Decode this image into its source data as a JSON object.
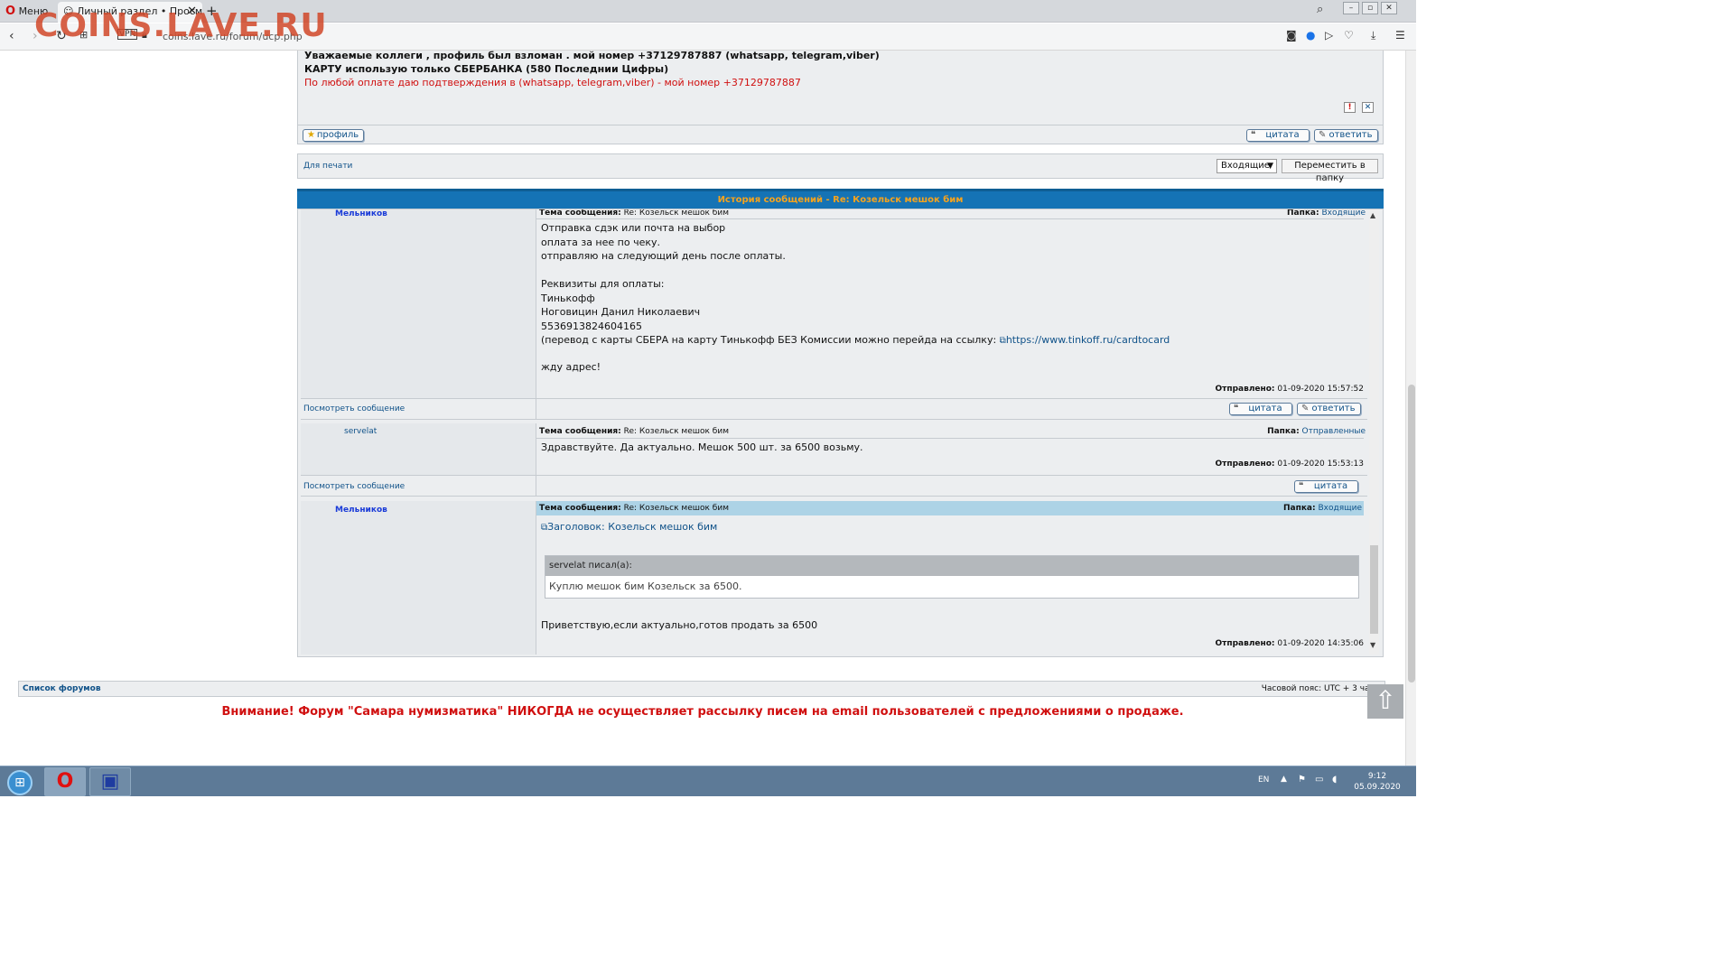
{
  "browser": {
    "menu_label": "Меню",
    "tab_title": "Личный раздел • Просмо",
    "url": "coins.lave.ru/forum/ucp.php",
    "watermark": "COINS.LAVE.RU"
  },
  "top_post": {
    "line1": "Уважаемые коллеги , профиль был взломан . мой номер +37129787887 (whatsapp, telegram,viber)",
    "line2": "КАРТУ использую только СБЕРБАНКА (580 Последнии Цифры)",
    "line3": "По любой оплате даю подтверждения в (whatsapp, telegram,viber) - мой номер +37129787887",
    "profile_label": "профиль",
    "quote_label": "цитата",
    "reply_label": "ответить"
  },
  "actions_row": {
    "print_label": "Для печати",
    "folder_select": "Входящие",
    "move_button": "Переместить в папку"
  },
  "history": {
    "header": "История сообщений - Re: Козельск мешок бим",
    "subject_label": "Тема сообщения:",
    "folder_label": "Папка:",
    "sent_label": "Отправлено:",
    "view_message": "Посмотреть сообщение",
    "quote_label": "цитата",
    "reply_label": "ответить",
    "messages": [
      {
        "author": "Мельников",
        "subject": "Re: Козельск мешок бим",
        "folder": "Входящие",
        "body": "Отправка сдэк или почта на выбор\nоплата за нее по чеку.\nотправляю на следующий день после оплаты.\n\nРеквизиты для оплаты:\nТинькофф\nНоговицин Данил Николаевич\n5536913824604165",
        "body_link_prefix": "(перевод с карты СБЕРА на карту Тинькофф БЕЗ Комиссии можно перейда на ссылку: ",
        "body_link": "https://www.tinkoff.ru/cardtocard",
        "body_end": "жду адрес!",
        "sent": "01-09-2020 15:57:52"
      },
      {
        "author": "servelat",
        "subject": "Re: Козельск мешок бим",
        "folder": "Отправленные",
        "body": "Здравствуйте. Да актуально. Мешок 500 шт. за 6500 возьму.",
        "sent": "01-09-2020 15:53:13"
      },
      {
        "author": "Мельников",
        "subject": "Re: Козельск мешок бим",
        "folder": "Входящие",
        "title_link": "Заголовок: Козельск мешок бим",
        "quote_author": "servelat писал(а):",
        "quote_text": "Куплю мешок бим Козельск за 6500.",
        "body": "Приветствую,если актуально,готов продать за 6500",
        "sent": "01-09-2020 14:35:06"
      }
    ]
  },
  "footer": {
    "forums_list": "Список форумов",
    "timezone": "Часовой пояс: UTC + 3 часа",
    "warning": "Внимание! Форум \"Самара нумизматика\" НИКОГДА не осуществляет рассылку писем на email пользователей с предложениями о продаже."
  },
  "taskbar": {
    "lang": "EN",
    "time": "9:12",
    "date": "05.09.2020"
  },
  "colors": {
    "header_blue": "#1573b5",
    "header_text": "#f7a31c",
    "warning_red": "#d01010",
    "link_blue": "#105289"
  }
}
